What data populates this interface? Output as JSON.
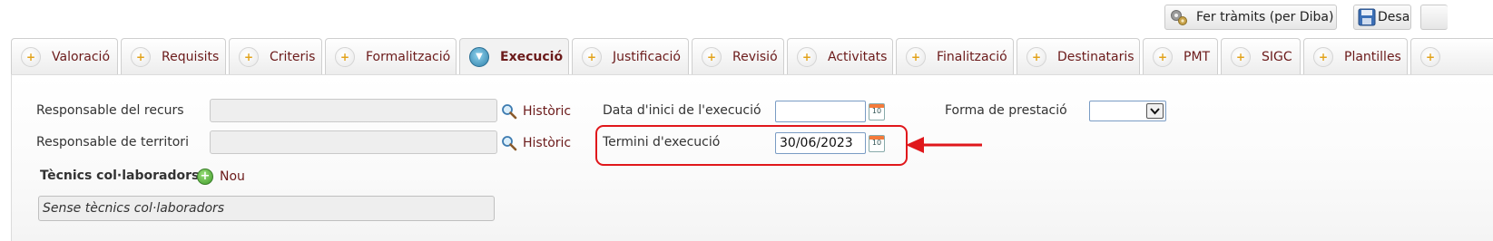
{
  "toolbar": {
    "tramits_label": "Fer tràmits (per Diba)",
    "save_label": "Desa"
  },
  "tabs": [
    {
      "label": "Valoració",
      "active": false
    },
    {
      "label": "Requisits",
      "active": false
    },
    {
      "label": "Criteris",
      "active": false
    },
    {
      "label": "Formalització",
      "active": false
    },
    {
      "label": "Execució",
      "active": true
    },
    {
      "label": "Justificació",
      "active": false
    },
    {
      "label": "Revisió",
      "active": false
    },
    {
      "label": "Activitats",
      "active": false
    },
    {
      "label": "Finalització",
      "active": false
    },
    {
      "label": "Destinataris",
      "active": false
    },
    {
      "label": "PMT",
      "active": false
    },
    {
      "label": "SIGC",
      "active": false
    },
    {
      "label": "Plantilles",
      "active": false
    }
  ],
  "form": {
    "responsable_recurs_label": "Responsable del recurs",
    "responsable_territori_label": "Responsable de territori",
    "historic_label": "Històric",
    "data_inici_label": "Data d'inici de l'execució",
    "data_inici_value": "",
    "termini_label": "Termini d'execució",
    "termini_value": "30/06/2023",
    "forma_prestacio_label": "Forma de prestació",
    "forma_prestacio_value": "",
    "calendar_icon_text": "10"
  },
  "tecnics": {
    "title": "Tècnics col·laboradors",
    "add_label": "Nou",
    "empty_text": "Sense tècnics col·laboradors"
  },
  "colors": {
    "tab_text": "#6b1a1a",
    "highlight_red": "#e0171b",
    "add_icon": "#3f9a2a"
  }
}
